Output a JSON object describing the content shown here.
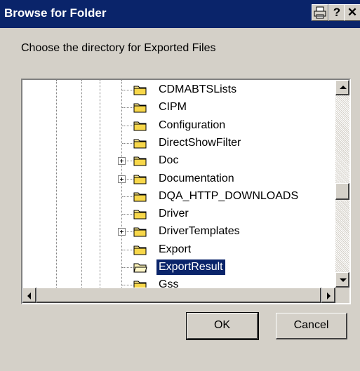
{
  "window": {
    "title": "Browse for Folder",
    "buttons": [
      "print-icon",
      "help-icon",
      "close-icon"
    ]
  },
  "instruction": "Choose the directory for Exported Files",
  "tree": {
    "items": [
      {
        "label": "CDMABTSLists",
        "expandable": false,
        "selected": false
      },
      {
        "label": "CIPM",
        "expandable": false,
        "selected": false
      },
      {
        "label": "Configuration",
        "expandable": false,
        "selected": false
      },
      {
        "label": "DirectShowFilter",
        "expandable": false,
        "selected": false
      },
      {
        "label": "Doc",
        "expandable": true,
        "selected": false
      },
      {
        "label": "Documentation",
        "expandable": true,
        "selected": false
      },
      {
        "label": "DQA_HTTP_DOWNLOADS",
        "expandable": false,
        "selected": false
      },
      {
        "label": "Driver",
        "expandable": false,
        "selected": false
      },
      {
        "label": "DriverTemplates",
        "expandable": true,
        "selected": false
      },
      {
        "label": "Export",
        "expandable": false,
        "selected": false
      },
      {
        "label": "ExportResult",
        "expandable": false,
        "selected": true
      },
      {
        "label": "Gss",
        "expandable": false,
        "selected": false
      }
    ],
    "vertical_scroll_position": 0.55
  },
  "actions": {
    "ok_label": "OK",
    "cancel_label": "Cancel"
  },
  "colors": {
    "titlebar": "#0a246a",
    "selection": "#0a246a",
    "face": "#d4d0c8"
  }
}
